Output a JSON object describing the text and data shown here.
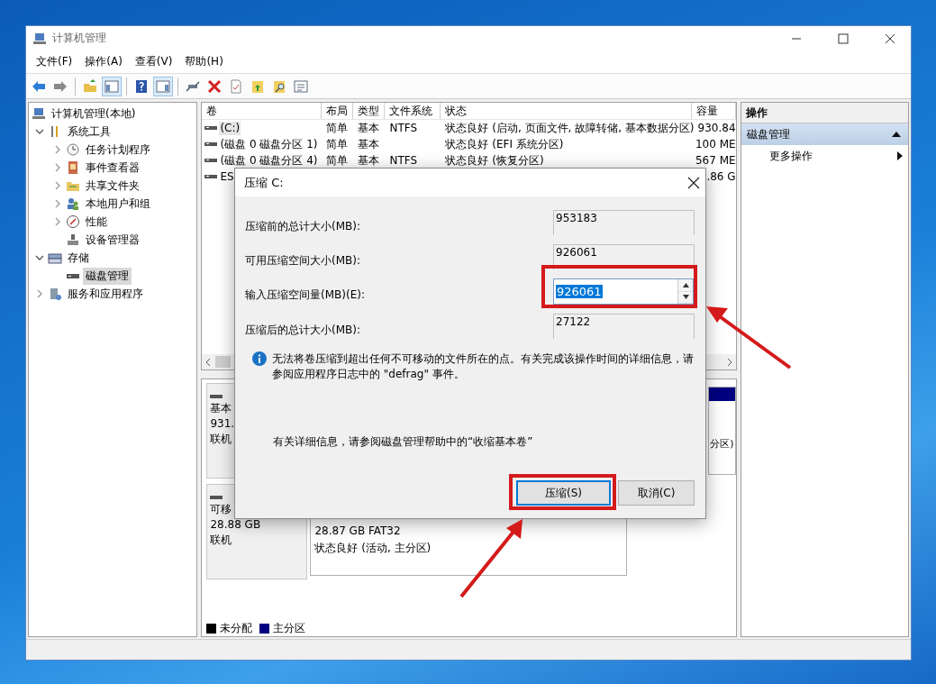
{
  "window": {
    "title": "计算机管理"
  },
  "menu": [
    "文件(F)",
    "操作(A)",
    "查看(V)",
    "帮助(H)"
  ],
  "toolbar": [
    {
      "pressed": false
    },
    {
      "pressed": false
    },
    {
      "pressed": false
    },
    {
      "pressed": true
    },
    {
      "pressed": false
    },
    {
      "pressed": true
    },
    {
      "pressed": false
    },
    {
      "pressed": false
    },
    {
      "pressed": false
    },
    {
      "pressed": false
    },
    {
      "pressed": false
    },
    {
      "pressed": false
    }
  ],
  "tree": [
    {
      "label": "计算机管理(本地)",
      "selected": false,
      "children": [
        {
          "label": "系统工具",
          "expanded": true,
          "selected": false,
          "children": [
            {
              "label": "任务计划程序",
              "expanded": false,
              "selected": false
            },
            {
              "label": "事件查看器",
              "expanded": false,
              "selected": false
            },
            {
              "label": "共享文件夹",
              "expanded": false,
              "selected": false
            },
            {
              "label": "本地用户和组",
              "expanded": false,
              "selected": false
            },
            {
              "label": "性能",
              "expanded": false,
              "selected": false
            },
            {
              "label": "设备管理器",
              "selected": false
            }
          ]
        },
        {
          "label": "存储",
          "expanded": true,
          "selected": false,
          "children": [
            {
              "label": "磁盘管理",
              "selected": true
            }
          ]
        },
        {
          "label": "服务和应用程序",
          "expanded": false,
          "selected": false
        }
      ]
    }
  ],
  "table": {
    "columns": [
      "卷",
      "布局",
      "类型",
      "文件系统",
      "状态",
      "容量"
    ],
    "rows": [
      {
        "volume": "(C:)",
        "layout": "简单",
        "type": "基本",
        "fs": "NTFS",
        "status": "状态良好 (启动, 页面文件, 故障转储, 基本数据分区)",
        "capacity": "930.84",
        "selected": true
      },
      {
        "volume": "(磁盘 0 磁盘分区 1)",
        "layout": "简单",
        "type": "基本",
        "status": "状态良好 (EFI 系统分区)",
        "capacity": "100 ME",
        "selected": false
      },
      {
        "volume": "(磁盘 0 磁盘分区 4)",
        "layout": "简单",
        "type": "基本",
        "fs": "NTFS",
        "status": "状态良好 (恢复分区)",
        "capacity": "567 ME",
        "selected": false
      },
      {
        "volume": "ES",
        "capacity": ".86 G",
        "selected": false
      }
    ]
  },
  "disks": [
    {
      "kind": "fixed",
      "label_lines": [
        "基本",
        "931.",
        "联机"
      ],
      "partitions": [
        {
          "lines": [
            "分区)"
          ]
        }
      ]
    },
    {
      "kind": "removable",
      "label_lines": [
        "可移",
        "28.88 GB",
        "联机"
      ],
      "partitions": [
        {
          "lines": [
            "28.87 GB FAT32",
            "状态良好 (活动, 主分区)"
          ]
        }
      ]
    }
  ],
  "legend": [
    {
      "label": "未分配",
      "color": "#000000"
    },
    {
      "label": "主分区",
      "color": "#000080"
    }
  ],
  "actions": {
    "title": "操作",
    "sections": [
      {
        "label": "磁盘管理",
        "expanded": true,
        "items": [
          "更多操作"
        ]
      }
    ]
  },
  "dialog": {
    "title": "压缩 C:",
    "fields": [
      {
        "kind": "readonly",
        "label": "压缩前的总计大小(MB):",
        "value": "953183"
      },
      {
        "kind": "readonly",
        "label": "可用压缩空间大小(MB):",
        "value": "926061"
      },
      {
        "kind": "spin",
        "label": "输入压缩空间量(MB)(E):",
        "value": "926061",
        "highlighted": true
      },
      {
        "kind": "readonly",
        "label": "压缩后的总计大小(MB):",
        "value": "27122"
      }
    ],
    "info": "无法将卷压缩到超出任何不可移动的文件所在的点。有关完成该操作时间的详细信息，请参阅应用程序日志中的 \"defrag\" 事件。",
    "help": "有关详细信息，请参阅磁盘管理帮助中的“收缩基本卷”",
    "buttons": [
      {
        "label": "压缩(S)",
        "default": true
      },
      {
        "label": "取消(C)",
        "default": false
      }
    ]
  }
}
